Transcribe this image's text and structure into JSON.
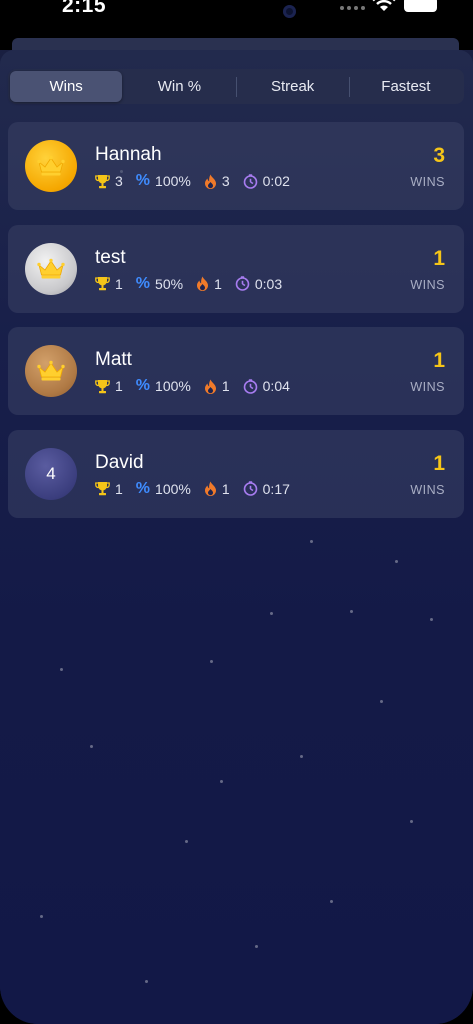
{
  "status_bar": {
    "time": "2:15"
  },
  "tabs": [
    {
      "label": "Wins",
      "active": true
    },
    {
      "label": "Win %",
      "active": false
    },
    {
      "label": "Streak",
      "active": false
    },
    {
      "label": "Fastest",
      "active": false
    }
  ],
  "players": [
    {
      "rank_badge": "gold",
      "rank": "",
      "name": "Hannah",
      "wins": "3",
      "win_pct": "100%",
      "streak": "3",
      "fastest": "0:02",
      "count": "3",
      "count_label": "WINS"
    },
    {
      "rank_badge": "silver",
      "rank": "",
      "name": "test",
      "wins": "1",
      "win_pct": "50%",
      "streak": "1",
      "fastest": "0:03",
      "count": "1",
      "count_label": "WINS"
    },
    {
      "rank_badge": "bronze",
      "rank": "",
      "name": "Matt",
      "wins": "1",
      "win_pct": "100%",
      "streak": "1",
      "fastest": "0:04",
      "count": "1",
      "count_label": "WINS"
    },
    {
      "rank_badge": "rank",
      "rank": "4",
      "name": "David",
      "wins": "1",
      "win_pct": "100%",
      "streak": "1",
      "fastest": "0:17",
      "count": "1",
      "count_label": "WINS"
    }
  ],
  "icons": {
    "wins": "trophy-icon",
    "win_pct": "percent-icon",
    "streak": "flame-icon",
    "fastest": "timer-icon",
    "top_rank": "crown-icon"
  },
  "colors": {
    "accent_gold": "#f5c518",
    "percent_blue": "#3f8cff",
    "flame_orange": "#f07a2a",
    "timer_purple": "#a77cf0"
  }
}
